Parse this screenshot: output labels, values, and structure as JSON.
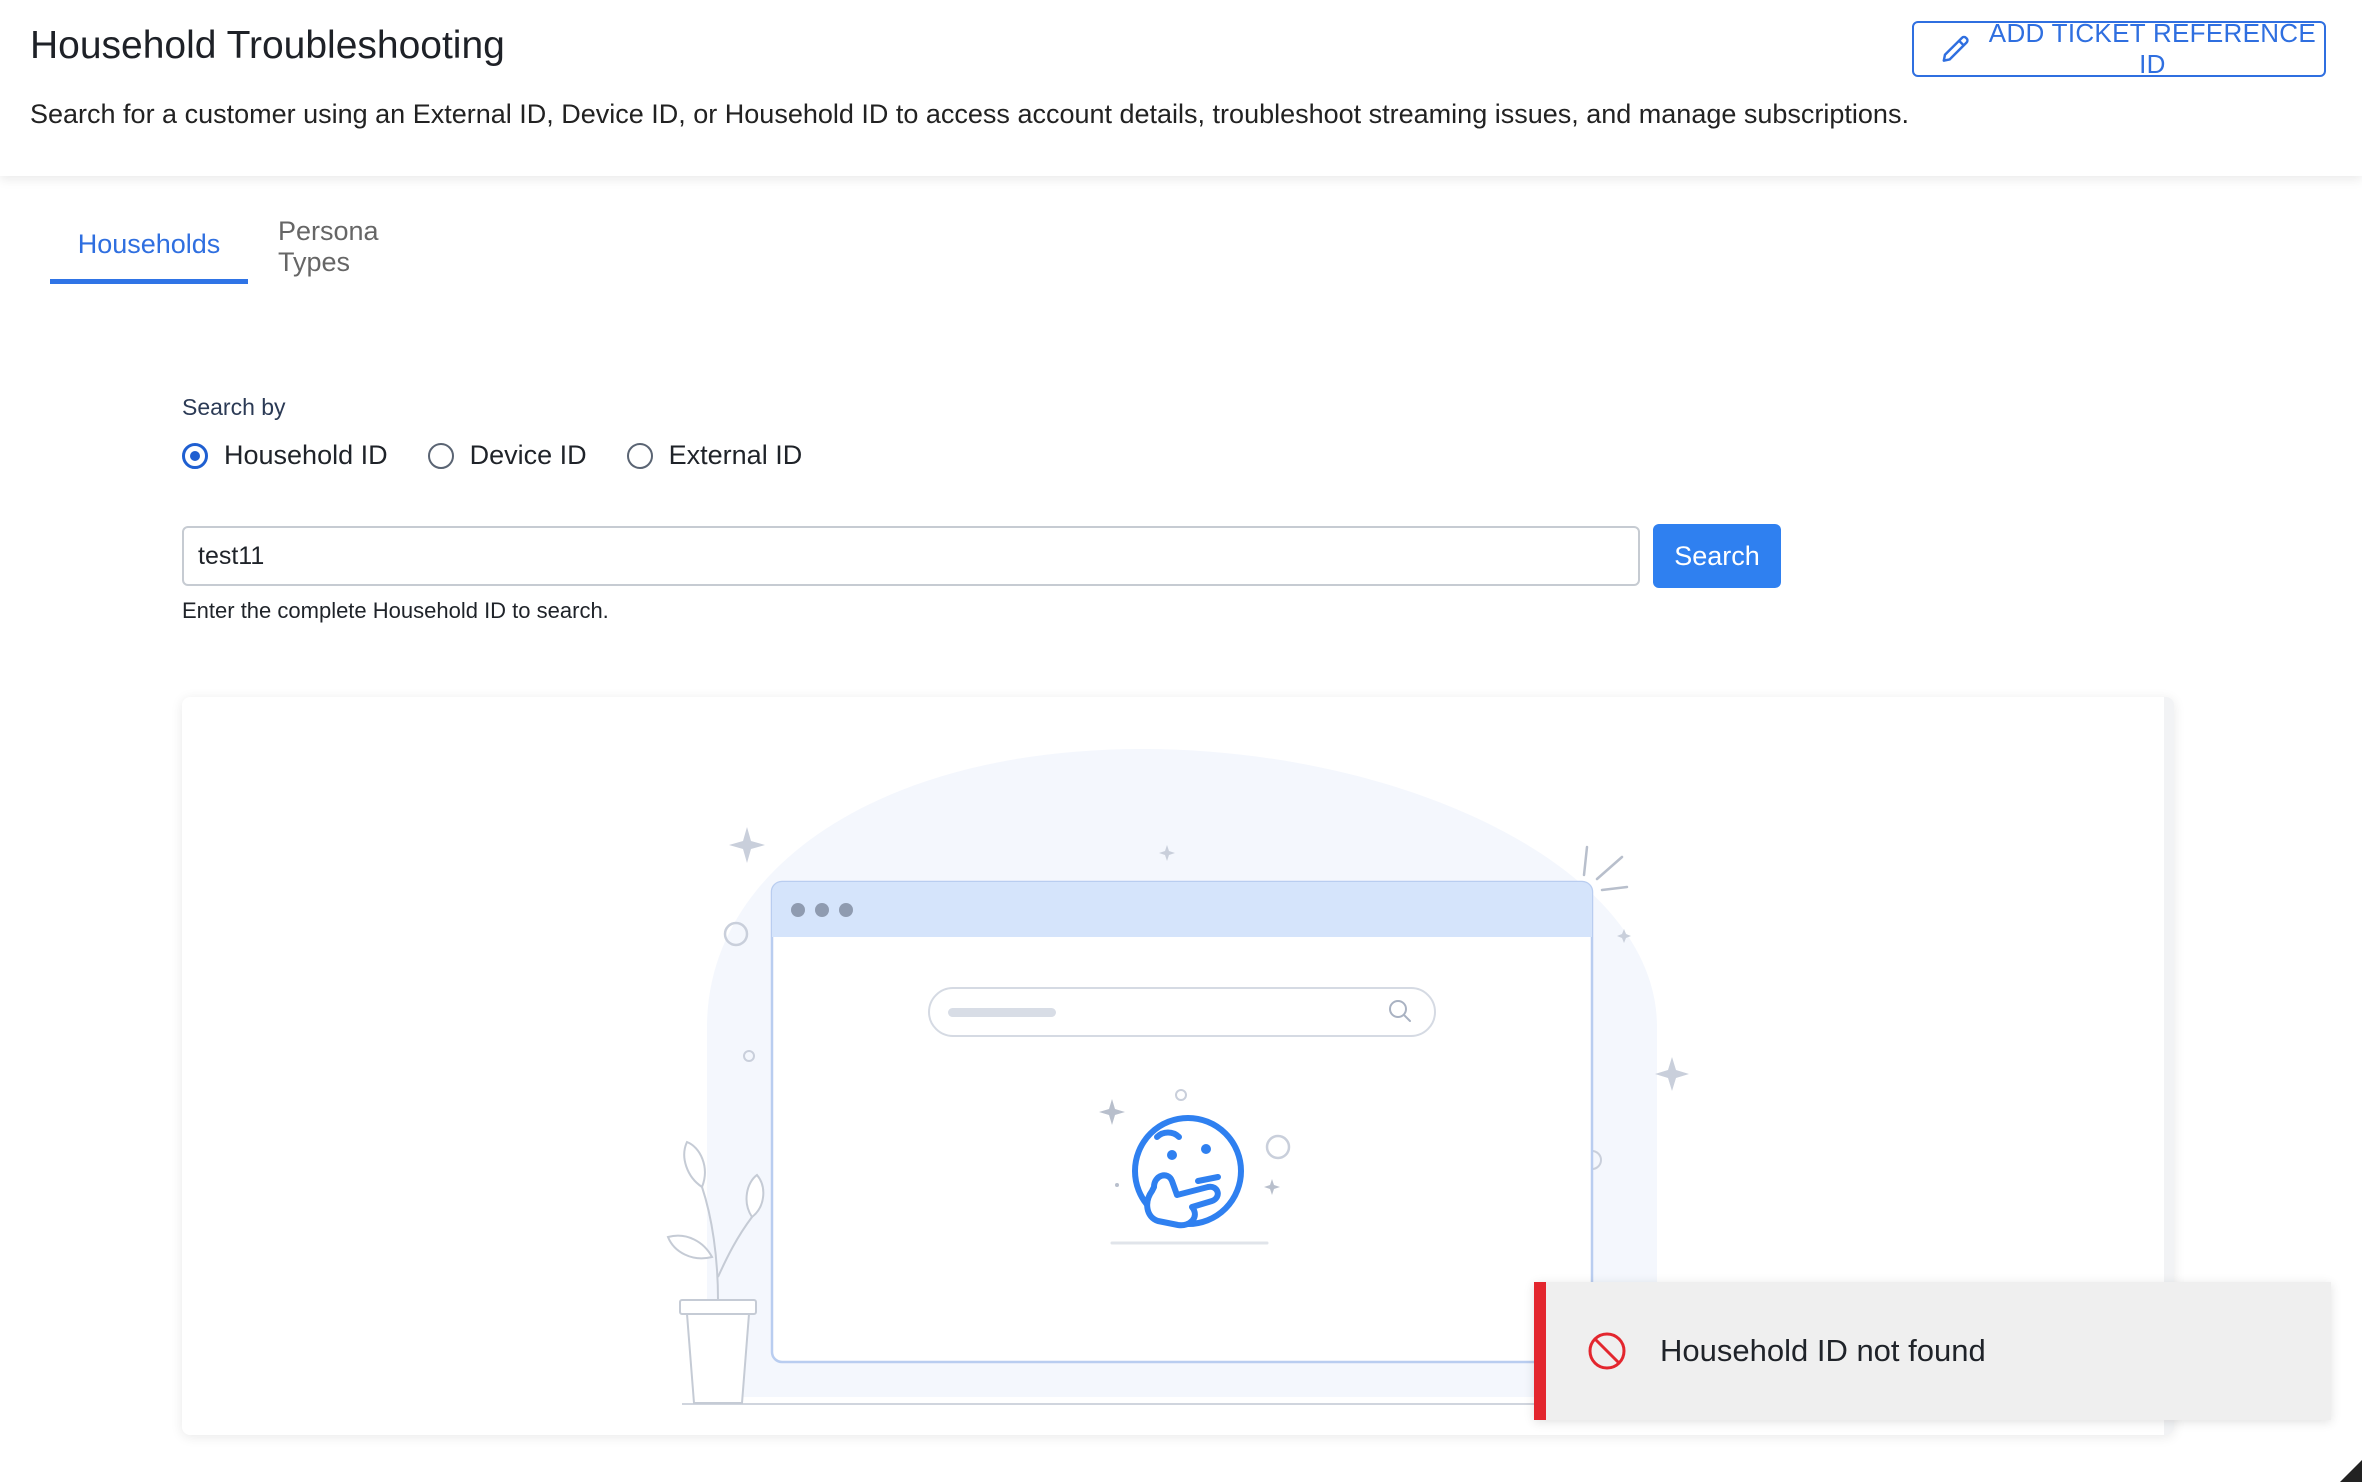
{
  "header": {
    "title": "Household Troubleshooting",
    "description": "Search for a customer using an External ID, Device ID, or Household ID to access account details, troubleshoot streaming issues, and manage subscriptions.",
    "ticket_button_label": "ADD TICKET REFERENCE ID",
    "ticket_button_icon": "pencil-icon"
  },
  "tabs": [
    {
      "label": "Households",
      "active": true
    },
    {
      "label": "Persona Types",
      "active": false
    }
  ],
  "search": {
    "search_by_label": "Search by",
    "options": [
      {
        "label": "Household ID",
        "selected": true
      },
      {
        "label": "Device ID",
        "selected": false
      },
      {
        "label": "External ID",
        "selected": false
      }
    ],
    "input_value": "test11",
    "button_label": "Search",
    "helper_text": "Enter the complete Household ID to search."
  },
  "empty_state": {
    "illustration": "thinking-face-browser-illustration"
  },
  "toast": {
    "message": "Household ID not found",
    "icon": "blocked-icon",
    "accent_color": "#e3262e"
  },
  "colors": {
    "primary": "#2f6fe0",
    "search_button": "#2f80f0"
  }
}
